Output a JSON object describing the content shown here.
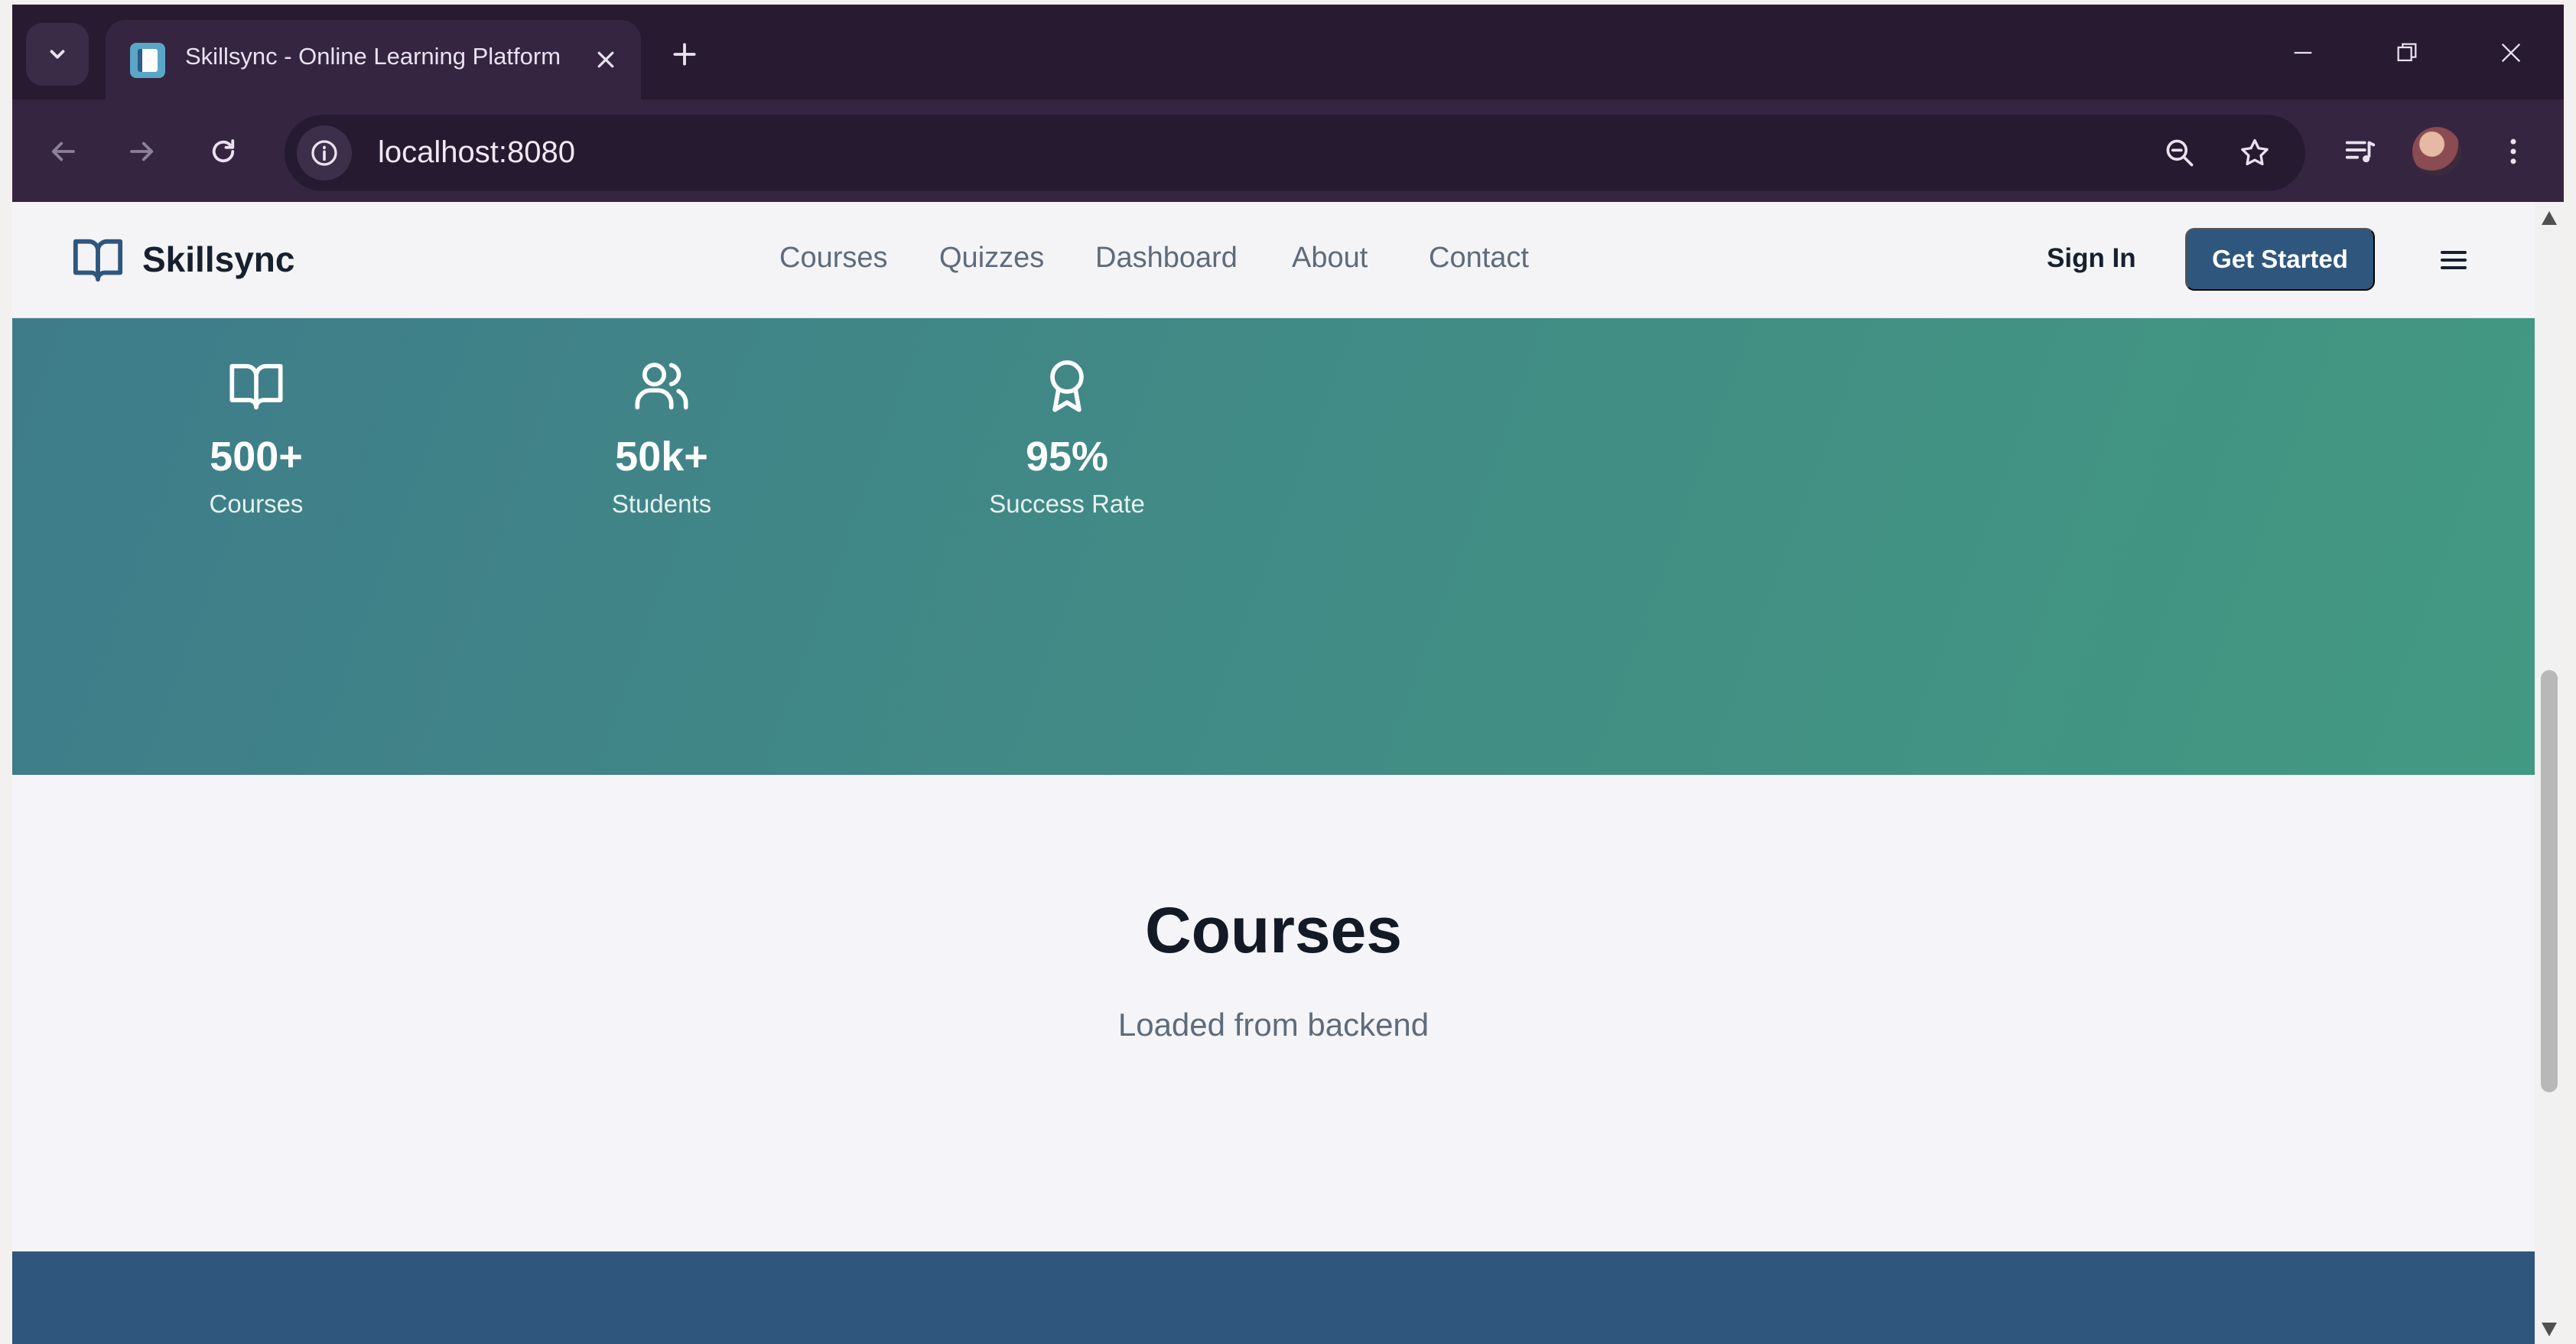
{
  "browser": {
    "tab_title": "Skillsync - Online Learning Platform",
    "url": "localhost:8080"
  },
  "header": {
    "brand": "Skillsync",
    "nav": [
      "Courses",
      "Quizzes",
      "Dashboard",
      "About",
      "Contact"
    ],
    "sign_in": "Sign In",
    "get_started": "Get Started"
  },
  "hero": {
    "stats": [
      {
        "icon": "book-open-icon",
        "value": "500+",
        "label": "Courses"
      },
      {
        "icon": "users-icon",
        "value": "50k+",
        "label": "Students"
      },
      {
        "icon": "award-icon",
        "value": "95%",
        "label": "Success Rate"
      }
    ]
  },
  "courses": {
    "title": "Courses",
    "subtitle": "Loaded from backend"
  },
  "colors": {
    "chrome_bg": "#271a31",
    "primary": "#2f567d",
    "hero_start": "#3e7c8a",
    "hero_end": "#429981"
  }
}
